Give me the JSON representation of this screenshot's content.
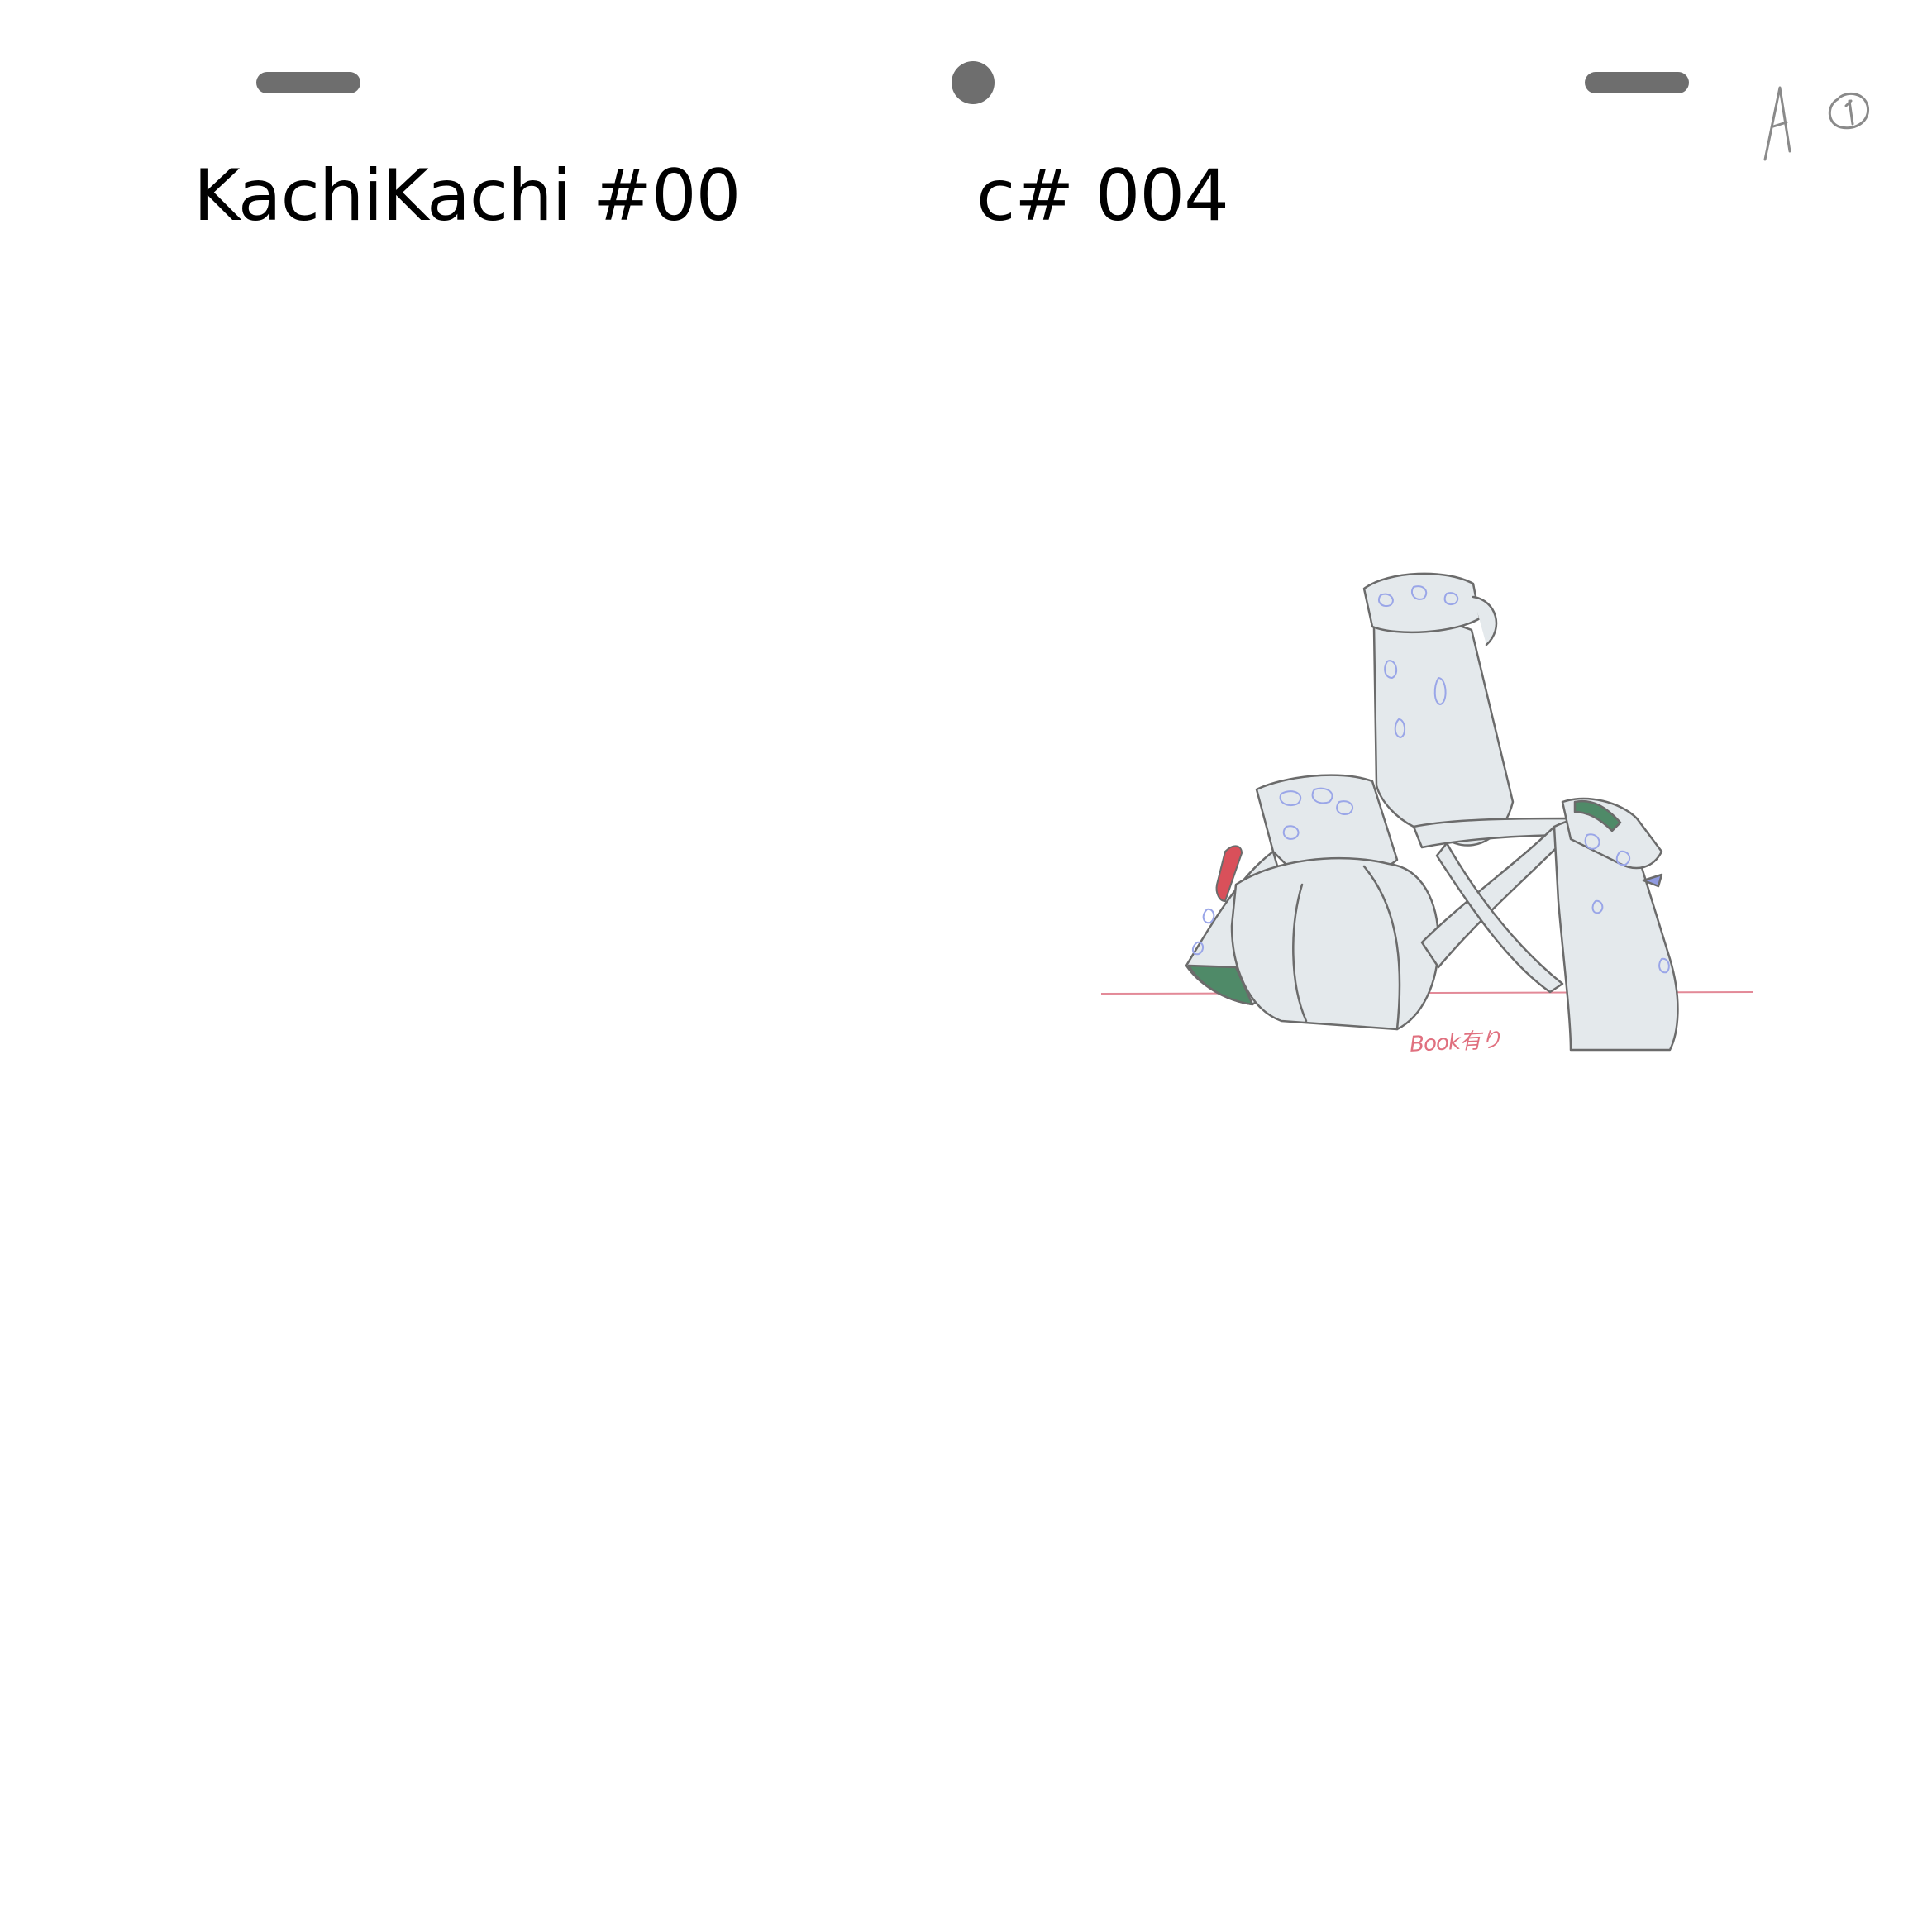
{
  "header": {
    "episode": "KachiKachi #00",
    "cut": "c# 004"
  },
  "sheet_mark": {
    "text": "A ①",
    "color": "#8a8a8a"
  },
  "drawing": {
    "note": "Book有り",
    "line_color": "#6b6b6b",
    "fill_color": "#e4e9ec",
    "shadow_color": "#9aa6e8",
    "accent_green": "#4f8a68",
    "accent_red": "#d9505a",
    "guide_line_color": "#e38a98"
  },
  "pegs": {
    "color": "#6e6e6e"
  }
}
